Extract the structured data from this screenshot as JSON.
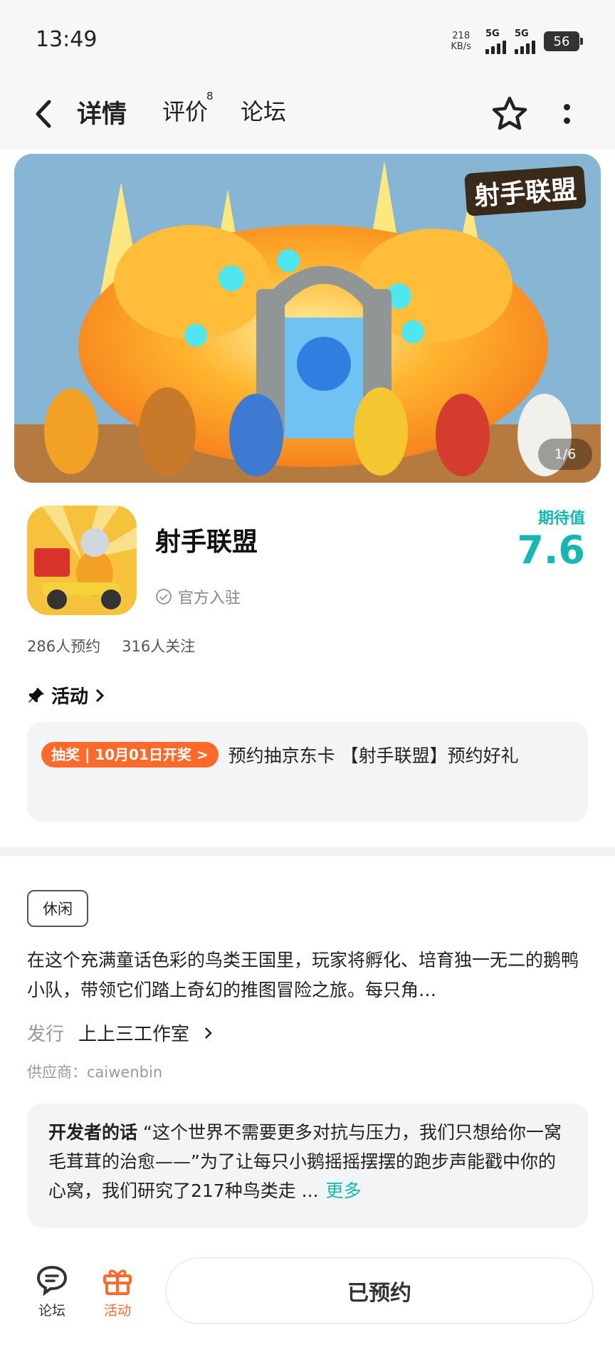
{
  "status_bar": {
    "time": "13:49",
    "net_speed_value": "218",
    "net_speed_unit": "KB/s",
    "signal1_label": "5G",
    "signal2_label": "5G",
    "battery": "56"
  },
  "nav": {
    "tabs": [
      {
        "label": "详情",
        "active": true
      },
      {
        "label": "评价",
        "badge": "8"
      },
      {
        "label": "论坛"
      }
    ],
    "icons": [
      "back-icon",
      "star-icon",
      "more-icon"
    ]
  },
  "banner": {
    "logo_text": "射手联盟",
    "page_indicator": "1/6"
  },
  "app": {
    "name": "射手联盟",
    "official_label": "官方入驻",
    "expect_label": "期待值",
    "expect_value": "7.6",
    "reservations": "286人预约",
    "followers": "316人关注"
  },
  "activity": {
    "title": "活动",
    "promo_tag": "抽奖 | 10月01日开奖 >",
    "promo_text": "预约抽京东卡 【射手联盟】预约好礼"
  },
  "details": {
    "genre_tag": "休闲",
    "description": "在这个充满童话色彩的鸟类王国里，玩家将孵化、培育独一无二的鹅鸭小队，带领它们踏上奇幻的推图冒险之旅。每只角…",
    "publisher_label": "发行",
    "publisher_name": "上上三工作室",
    "supplier": "供应商：caiwenbin"
  },
  "developer_note": {
    "label": "开发者的话",
    "text": "“这个世界不需要更多对抗与压力，我们只想给你一窝毛茸茸的治愈——”为了让每只小鹅摇摇摆摆的跑步声能戳中你的心窝，我们研究了217种鸟类走 ...",
    "more": "更多"
  },
  "bottom_bar": {
    "forum_label": "论坛",
    "activity_label": "活动",
    "reserve_button": "已预约"
  },
  "colors": {
    "accent": "#14b8b0",
    "tab_underline": "#14c8be",
    "promo": "#ff6a2b"
  }
}
